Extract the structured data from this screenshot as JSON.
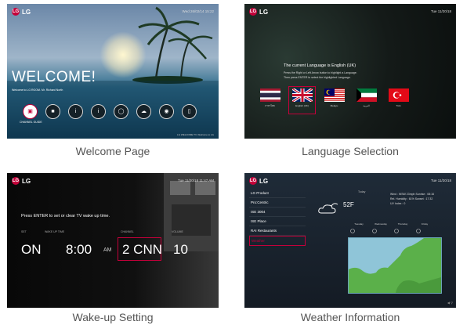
{
  "captions": {
    "welcome": "Welcome Page",
    "language": "Language Selection",
    "wakeup": "Wake-up Setting",
    "weather": "Weather Information"
  },
  "brand": "LG",
  "brand_color": "#c4003a",
  "welcome_page": {
    "datetime": "Wed 26/02/14 15:22",
    "heading": "WELCOME!",
    "subtext": "Welcome to LG ROOM. Mr. Richard North",
    "selected_icon_label": "CHANNEL GUIDE",
    "footer": "LG WELCOME TV, Welcome to LG",
    "icons": [
      "tv-icon",
      "info-icon",
      "info-icon",
      "info-icon",
      "globe-icon",
      "weather-icon",
      "alarm-icon",
      "mobile-icon"
    ]
  },
  "language_page": {
    "datetime": "Tue 11/20/18",
    "title": "The current Language is English (UK)",
    "instr1": "Press the Right or Left Arrow button to highlight a Language.",
    "instr2": "Then press ENTER to select the highlighted Language.",
    "flags": [
      {
        "label": "ภาษาไทย",
        "icon": "thai-flag-icon"
      },
      {
        "label": "English (UK)",
        "icon": "uk-flag-icon"
      },
      {
        "label": "Melayu",
        "icon": "malaysia-flag-icon"
      },
      {
        "label": "العربية",
        "icon": "kuwait-flag-icon"
      },
      {
        "label": "Türk",
        "icon": "turkey-flag-icon"
      }
    ]
  },
  "wakeup_page": {
    "datetime": "Tue 11/20/18 11:47 AM",
    "prompt": "Press ENTER to set or clear TV wake up time.",
    "labels": {
      "set": "SET",
      "time": "WAKE UP TIME",
      "channel": "CHANNEL",
      "volume": "VOLUME"
    },
    "values": {
      "set": "ON",
      "time": "8:00",
      "ampm": "AM",
      "channel": "2 CNN",
      "volume": "10"
    }
  },
  "weather_page": {
    "datetime": "Tue 11/20/18",
    "menu": [
      "LG Product",
      "Pro:Centric",
      "ISE 3004",
      "ISE Place",
      "RAI Restaurants",
      "Weather"
    ],
    "today_label": "Today",
    "temperature": "52F",
    "wind_line": "Wind : WSW 23mph  Sunrise : 08:16",
    "humidity_line": "Rel. Humidity : 61%  Sunset : 17:32",
    "uv_line": "UV Index : 0",
    "forecast_days": [
      "Tuesday",
      "Wednesday",
      "Thursday",
      "Friday"
    ],
    "screenshot_hint": "◀ ⚲"
  }
}
